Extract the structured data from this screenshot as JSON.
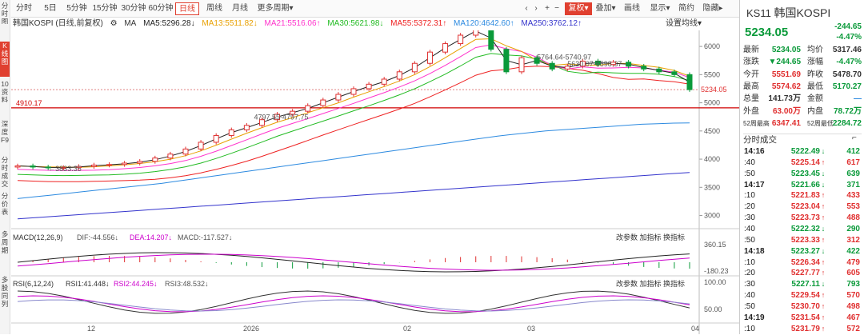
{
  "sidebar_left": [
    "分时图",
    "K线图",
    "10资料",
    "深度F9",
    "分时成交",
    "分价表",
    "多周期",
    "多股同列"
  ],
  "toolbar": {
    "periods": [
      "分时",
      "5日",
      "5分钟",
      "15分钟",
      "30分钟",
      "60分钟",
      "日线",
      "周线",
      "月线",
      "更多周期"
    ],
    "active_period": "日线",
    "tools": [
      "复权",
      "叠加",
      "画线",
      "显示",
      "简约",
      "隐藏"
    ]
  },
  "legend": {
    "name": "韩国KOSPI (日线,前复权)",
    "ma": "MA",
    "ma5": "MA5:5296.28↓",
    "ma13": "MA13:5511.82↓",
    "ma21": "MA21:5516.06↑",
    "ma30": "MA30:5621.98↓",
    "ma55": "MA55:5372.31↑",
    "ma120": "MA120:4642.60↑",
    "ma250": "MA250:3762.12↑",
    "settings": "设置均线"
  },
  "colors": {
    "up": "#e03030",
    "down": "#0a9a3a",
    "ma5": "#222",
    "ma13": "#e8a000",
    "ma21": "#ff33cc",
    "ma30": "#22bb22",
    "ma55": "#ee2222",
    "ma120": "#2c8ae0",
    "ma250": "#3333cc"
  },
  "chart_data": {
    "type": "line",
    "title": "韩国KOSPI (日线,前复权)",
    "x_ticks": [
      "12",
      "2026",
      "02",
      "03",
      "04"
    ],
    "y_ticks": [
      3000,
      3500,
      4000,
      4500,
      5000,
      5500,
      6000
    ],
    "ylim": [
      2880,
      6200
    ],
    "series": [
      {
        "name": "close",
        "values": [
          3880,
          3860,
          3845,
          3850,
          3870,
          3895,
          3905,
          3930,
          3960,
          4020,
          4090,
          4180,
          4300,
          4420,
          4520,
          4600,
          4700,
          4797,
          4850,
          4950,
          5050,
          5150,
          5250,
          5330,
          5420,
          5550,
          5700,
          5900,
          6050,
          6200,
          6347,
          5950,
          5550,
          5800,
          5700,
          5600,
          5650,
          5740,
          5680,
          5720,
          5650,
          5600,
          5550,
          5500,
          5234
        ]
      },
      {
        "name": "MA120",
        "values": [
          3300,
          3330,
          3360,
          3390,
          3420,
          3450,
          3480,
          3510,
          3540,
          3570,
          3610,
          3650,
          3690,
          3730,
          3770,
          3810,
          3850,
          3890,
          3930,
          3970,
          4010,
          4050,
          4090,
          4130,
          4170,
          4210,
          4250,
          4290,
          4330,
          4370,
          4410,
          4440,
          4470,
          4500,
          4520,
          4540,
          4560,
          4580,
          4600,
          4620,
          4630,
          4640,
          4643
        ]
      },
      {
        "name": "MA250",
        "values": [
          2940,
          2965,
          2990,
          3015,
          3040,
          3065,
          3090,
          3115,
          3140,
          3165,
          3190,
          3215,
          3240,
          3265,
          3290,
          3315,
          3340,
          3365,
          3390,
          3415,
          3440,
          3465,
          3490,
          3515,
          3540,
          3565,
          3590,
          3615,
          3640,
          3665,
          3690,
          3715,
          3740,
          3762
        ]
      }
    ],
    "annotations": [
      "6347.41",
      "5764.64-5740.97",
      "5630.07-5598.37",
      "4797.55-4797.75",
      "3833.35",
      "4910.17",
      "5234.05"
    ],
    "hline": 4910.17,
    "last": 5234.05
  },
  "macd": {
    "label": "MACD(12,26,9)",
    "dif": "DIF:-44.556↓",
    "dea": "DEA:14.207↓",
    "macd": "MACD:-117.527↓",
    "hi": "360.15",
    "lo": "-180.23",
    "links": [
      "改参数",
      "加指标",
      "换指标"
    ]
  },
  "rsi": {
    "label": "RSI(6,12,24)",
    "r1": "RSI1:41.448↓",
    "r2": "RSI2:44.245↓",
    "r3": "RSI3:48.532↓",
    "hi": "100.00",
    "mid": "50.00",
    "links": [
      "改参数",
      "加指标",
      "换指标"
    ]
  },
  "quote": {
    "code": "KS11",
    "name": "韩国KOSPI",
    "price": "5234.05",
    "change": "-244.65",
    "pct": "-4.47%",
    "rows": [
      [
        "最新",
        "5234.05",
        "均价",
        "5317.46"
      ],
      [
        "涨跌",
        "▼244.65",
        "涨幅",
        "-4.47%"
      ],
      [
        "今开",
        "5551.69",
        "昨收",
        "5478.70"
      ],
      [
        "最高",
        "5574.62",
        "最低",
        "5170.27"
      ],
      [
        "总量",
        "141.73万",
        "金额",
        "—"
      ],
      [
        "外盘",
        "63.00万",
        "内盘",
        "78.72万"
      ],
      [
        "52周最高",
        "6347.41",
        "52周最低",
        "2284.72"
      ]
    ],
    "ticks_title": "分时成交",
    "ticks": [
      [
        "14:16",
        "5222.49",
        "↓",
        "412",
        "g"
      ],
      [
        ":40",
        "5225.14",
        "↑",
        "617",
        "r"
      ],
      [
        ":50",
        "5223.45",
        "↓",
        "639",
        "g"
      ],
      [
        "14:17",
        "5221.66",
        "↓",
        "371",
        "g"
      ],
      [
        ":10",
        "5221.83",
        "↑",
        "433",
        "r"
      ],
      [
        ":20",
        "5223.04",
        "↑",
        "553",
        "r"
      ],
      [
        ":30",
        "5223.73",
        "↑",
        "488",
        "r"
      ],
      [
        ":40",
        "5222.32",
        "↓",
        "290",
        "g"
      ],
      [
        ":50",
        "5223.33",
        "↑",
        "312",
        "r"
      ],
      [
        "14:18",
        "5223.27",
        "↓",
        "422",
        "g"
      ],
      [
        ":10",
        "5226.34",
        "↑",
        "479",
        "r"
      ],
      [
        ":20",
        "5227.77",
        "↑",
        "605",
        "r"
      ],
      [
        ":30",
        "5227.11",
        "↓",
        "793",
        "g"
      ],
      [
        ":40",
        "5229.54",
        "↑",
        "570",
        "r"
      ],
      [
        ":50",
        "5230.70",
        "↑",
        "498",
        "r"
      ],
      [
        "14:19",
        "5231.54",
        "↑",
        "467",
        "r"
      ],
      [
        ":10",
        "5231.79",
        "↑",
        "572",
        "r"
      ]
    ]
  }
}
